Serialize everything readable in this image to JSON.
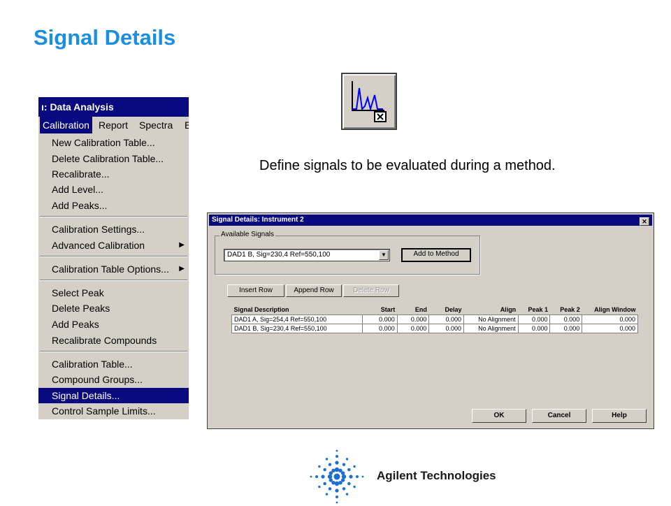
{
  "slide": {
    "title": "Signal Details",
    "description": "Define signals to be evaluated during a method."
  },
  "menu": {
    "window_title": "ı: Data Analysis",
    "menubar": [
      "Calibration",
      "Report",
      "Spectra",
      "E"
    ],
    "items": [
      {
        "label": "New Calibration Table..."
      },
      {
        "label": "Delete Calibration Table..."
      },
      {
        "label": "Recalibrate..."
      },
      {
        "label": "Add Level..."
      },
      {
        "label": "Add Peaks..."
      },
      {
        "label": "Calibration Settings..."
      },
      {
        "label": "Advanced Calibration"
      },
      {
        "label": "Calibration Table Options..."
      },
      {
        "label": "Select Peak"
      },
      {
        "label": "Delete Peaks"
      },
      {
        "label": "Add Peaks"
      },
      {
        "label": "Recalibrate Compounds"
      },
      {
        "label": "Calibration Table..."
      },
      {
        "label": "Compound Groups..."
      },
      {
        "label": "Signal Details..."
      },
      {
        "label": "Control Sample Limits..."
      }
    ],
    "submenu_arrow": "▶"
  },
  "dialog": {
    "title": "Signal Details: Instrument 2",
    "close": "✕",
    "available_signals_label": "Available Signals",
    "selected_signal": "DAD1 B, Sig=230,4 Ref=550,100",
    "add_to_method": "Add to Method",
    "insert_row": "Insert Row",
    "append_row": "Append Row",
    "delete_row": "Delete Row",
    "columns": [
      "Signal Description",
      "Start",
      "End",
      "Delay",
      "Align",
      "Peak 1",
      "Peak 2",
      "Align Window"
    ],
    "rows": [
      [
        "DAD1 A, Sig=254,4 Ref=550,100",
        "0.000",
        "0.000",
        "0.000",
        "No Alignment",
        "0.000",
        "0.000",
        "0.000"
      ],
      [
        "DAD1 B, Sig=230,4 Ref=550,100",
        "0.000",
        "0.000",
        "0.000",
        "No Alignment",
        "0.000",
        "0.000",
        "0.000"
      ]
    ],
    "ok": "OK",
    "cancel": "Cancel",
    "help": "Help"
  },
  "footer": {
    "company": "Agilent Technologies"
  },
  "colors": {
    "title_blue": "#1a8fe0",
    "win_titlebar": "#0a0a80",
    "win_face": "#d4d0c8",
    "logo_blue": "#1c6fd1"
  },
  "icons": {
    "toolbar": "signal-details-icon",
    "logo": "agilent-spark-logo"
  }
}
